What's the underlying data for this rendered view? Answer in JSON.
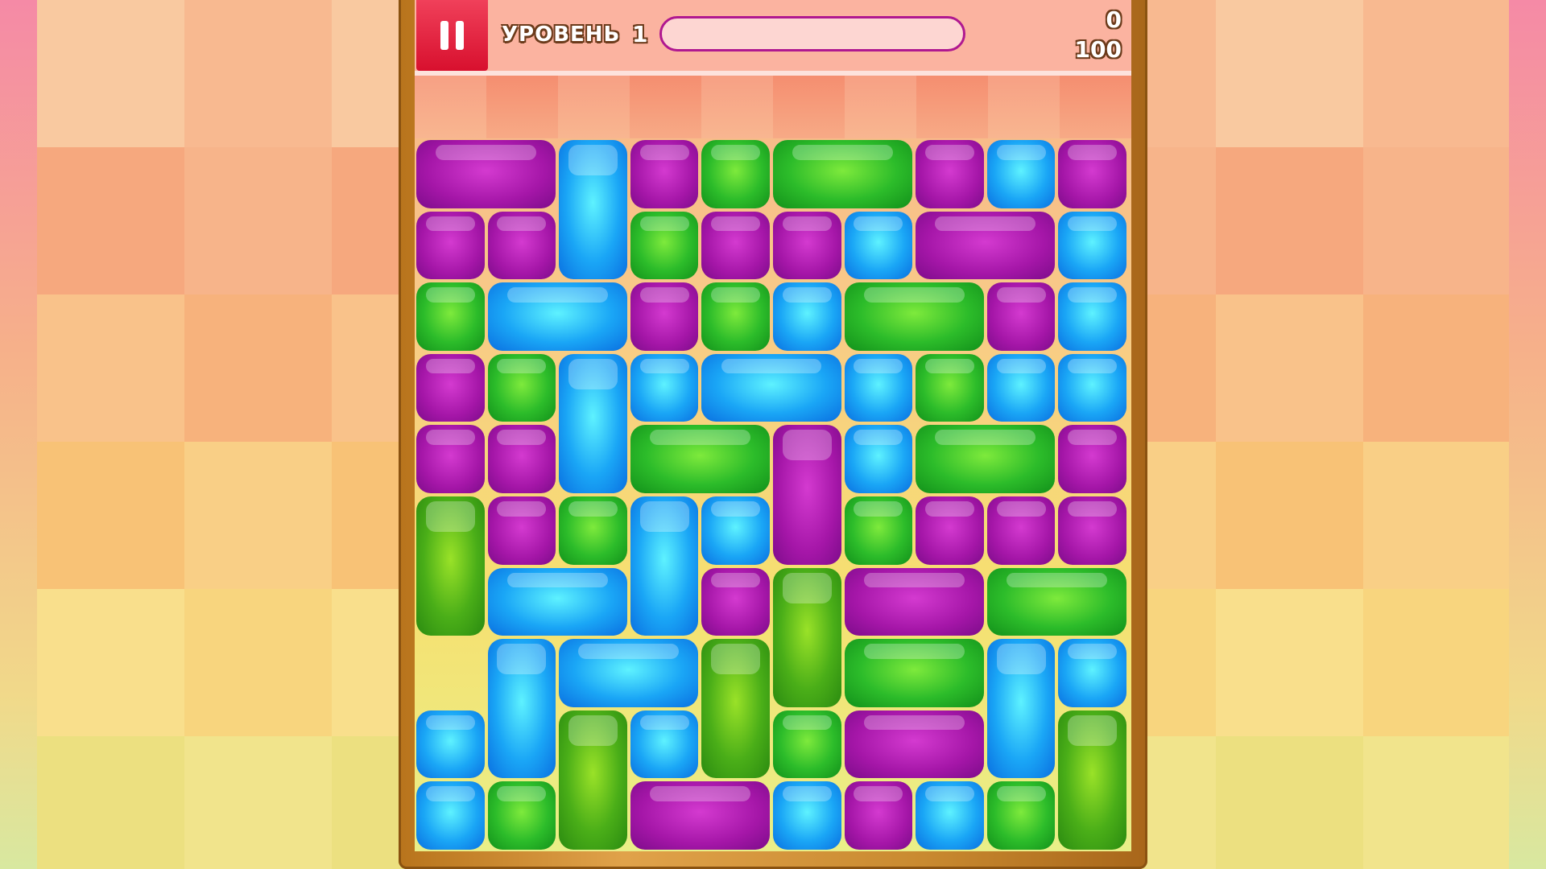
{
  "hud": {
    "level_label": "УРОВЕНЬ",
    "level_number": "1",
    "score_current": "0",
    "score_target": "100",
    "progress_fraction": 0
  },
  "colors": {
    "purple": "#b01ab0",
    "blue": "#1aa6f6",
    "green": "#2cbc2a",
    "pause": "#e0203e"
  },
  "board": {
    "columns": 10,
    "rows": 10,
    "blocks": [
      {
        "c": 0,
        "r": 0,
        "w": 2,
        "h": 1,
        "color": "purple"
      },
      {
        "c": 2,
        "r": 0,
        "w": 1,
        "h": 2,
        "color": "blue"
      },
      {
        "c": 3,
        "r": 0,
        "w": 1,
        "h": 1,
        "color": "purple"
      },
      {
        "c": 4,
        "r": 0,
        "w": 1,
        "h": 1,
        "color": "green"
      },
      {
        "c": 5,
        "r": 0,
        "w": 2,
        "h": 1,
        "color": "green"
      },
      {
        "c": 7,
        "r": 0,
        "w": 1,
        "h": 1,
        "color": "purple"
      },
      {
        "c": 8,
        "r": 0,
        "w": 1,
        "h": 1,
        "color": "blue"
      },
      {
        "c": 9,
        "r": 0,
        "w": 1,
        "h": 1,
        "color": "purple"
      },
      {
        "c": 0,
        "r": 1,
        "w": 1,
        "h": 1,
        "color": "purple"
      },
      {
        "c": 1,
        "r": 1,
        "w": 1,
        "h": 1,
        "color": "purple"
      },
      {
        "c": 3,
        "r": 1,
        "w": 1,
        "h": 1,
        "color": "green"
      },
      {
        "c": 4,
        "r": 1,
        "w": 1,
        "h": 1,
        "color": "purple"
      },
      {
        "c": 5,
        "r": 1,
        "w": 1,
        "h": 1,
        "color": "purple"
      },
      {
        "c": 6,
        "r": 1,
        "w": 1,
        "h": 1,
        "color": "blue"
      },
      {
        "c": 7,
        "r": 1,
        "w": 2,
        "h": 1,
        "color": "purple"
      },
      {
        "c": 9,
        "r": 1,
        "w": 1,
        "h": 1,
        "color": "blue"
      },
      {
        "c": 0,
        "r": 2,
        "w": 1,
        "h": 1,
        "color": "green"
      },
      {
        "c": 1,
        "r": 2,
        "w": 2,
        "h": 1,
        "color": "blue"
      },
      {
        "c": 3,
        "r": 2,
        "w": 1,
        "h": 1,
        "color": "purple"
      },
      {
        "c": 4,
        "r": 2,
        "w": 1,
        "h": 1,
        "color": "green"
      },
      {
        "c": 5,
        "r": 2,
        "w": 1,
        "h": 1,
        "color": "blue"
      },
      {
        "c": 6,
        "r": 2,
        "w": 2,
        "h": 1,
        "color": "green"
      },
      {
        "c": 8,
        "r": 2,
        "w": 1,
        "h": 1,
        "color": "purple"
      },
      {
        "c": 9,
        "r": 2,
        "w": 1,
        "h": 1,
        "color": "blue"
      },
      {
        "c": 0,
        "r": 3,
        "w": 1,
        "h": 1,
        "color": "purple"
      },
      {
        "c": 1,
        "r": 3,
        "w": 1,
        "h": 1,
        "color": "green"
      },
      {
        "c": 2,
        "r": 3,
        "w": 1,
        "h": 2,
        "color": "blue"
      },
      {
        "c": 3,
        "r": 3,
        "w": 1,
        "h": 1,
        "color": "blue"
      },
      {
        "c": 4,
        "r": 3,
        "w": 2,
        "h": 1,
        "color": "blue"
      },
      {
        "c": 6,
        "r": 3,
        "w": 1,
        "h": 1,
        "color": "blue"
      },
      {
        "c": 7,
        "r": 3,
        "w": 1,
        "h": 1,
        "color": "green"
      },
      {
        "c": 8,
        "r": 3,
        "w": 1,
        "h": 1,
        "color": "blue"
      },
      {
        "c": 9,
        "r": 3,
        "w": 1,
        "h": 1,
        "color": "blue"
      },
      {
        "c": 0,
        "r": 4,
        "w": 1,
        "h": 1,
        "color": "purple"
      },
      {
        "c": 1,
        "r": 4,
        "w": 1,
        "h": 1,
        "color": "purple"
      },
      {
        "c": 3,
        "r": 4,
        "w": 2,
        "h": 1,
        "color": "green"
      },
      {
        "c": 5,
        "r": 4,
        "w": 1,
        "h": 2,
        "color": "purple"
      },
      {
        "c": 6,
        "r": 4,
        "w": 1,
        "h": 1,
        "color": "blue"
      },
      {
        "c": 7,
        "r": 4,
        "w": 2,
        "h": 1,
        "color": "green"
      },
      {
        "c": 9,
        "r": 4,
        "w": 1,
        "h": 1,
        "color": "purple"
      },
      {
        "c": 0,
        "r": 5,
        "w": 1,
        "h": 2,
        "color": "green"
      },
      {
        "c": 1,
        "r": 5,
        "w": 1,
        "h": 1,
        "color": "purple"
      },
      {
        "c": 2,
        "r": 5,
        "w": 1,
        "h": 1,
        "color": "green"
      },
      {
        "c": 3,
        "r": 5,
        "w": 1,
        "h": 2,
        "color": "blue"
      },
      {
        "c": 4,
        "r": 5,
        "w": 1,
        "h": 1,
        "color": "blue"
      },
      {
        "c": 6,
        "r": 5,
        "w": 1,
        "h": 1,
        "color": "green"
      },
      {
        "c": 7,
        "r": 5,
        "w": 1,
        "h": 1,
        "color": "purple"
      },
      {
        "c": 8,
        "r": 5,
        "w": 1,
        "h": 1,
        "color": "purple"
      },
      {
        "c": 9,
        "r": 5,
        "w": 1,
        "h": 1,
        "color": "purple"
      },
      {
        "c": 1,
        "r": 6,
        "w": 2,
        "h": 1,
        "color": "blue"
      },
      {
        "c": 4,
        "r": 6,
        "w": 1,
        "h": 1,
        "color": "purple"
      },
      {
        "c": 5,
        "r": 6,
        "w": 1,
        "h": 2,
        "color": "green"
      },
      {
        "c": 6,
        "r": 6,
        "w": 2,
        "h": 1,
        "color": "purple"
      },
      {
        "c": 8,
        "r": 6,
        "w": 2,
        "h": 1,
        "color": "green"
      },
      {
        "c": 1,
        "r": 7,
        "w": 1,
        "h": 2,
        "color": "blue"
      },
      {
        "c": 2,
        "r": 7,
        "w": 2,
        "h": 1,
        "color": "blue"
      },
      {
        "c": 4,
        "r": 7,
        "w": 1,
        "h": 2,
        "color": "green"
      },
      {
        "c": 6,
        "r": 7,
        "w": 2,
        "h": 1,
        "color": "green"
      },
      {
        "c": 8,
        "r": 7,
        "w": 1,
        "h": 2,
        "color": "blue"
      },
      {
        "c": 9,
        "r": 7,
        "w": 1,
        "h": 1,
        "color": "blue"
      },
      {
        "c": 0,
        "r": 8,
        "w": 1,
        "h": 1,
        "color": "blue"
      },
      {
        "c": 2,
        "r": 8,
        "w": 1,
        "h": 2,
        "color": "green"
      },
      {
        "c": 3,
        "r": 8,
        "w": 1,
        "h": 1,
        "color": "blue"
      },
      {
        "c": 5,
        "r": 8,
        "w": 1,
        "h": 1,
        "color": "green"
      },
      {
        "c": 6,
        "r": 8,
        "w": 2,
        "h": 1,
        "color": "purple"
      },
      {
        "c": 9,
        "r": 8,
        "w": 1,
        "h": 2,
        "color": "green"
      },
      {
        "c": 0,
        "r": 9,
        "w": 1,
        "h": 1,
        "color": "blue"
      },
      {
        "c": 1,
        "r": 9,
        "w": 1,
        "h": 1,
        "color": "green"
      },
      {
        "c": 3,
        "r": 9,
        "w": 2,
        "h": 1,
        "color": "purple"
      },
      {
        "c": 5,
        "r": 9,
        "w": 1,
        "h": 1,
        "color": "blue"
      },
      {
        "c": 6,
        "r": 9,
        "w": 1,
        "h": 1,
        "color": "purple"
      },
      {
        "c": 7,
        "r": 9,
        "w": 1,
        "h": 1,
        "color": "blue"
      },
      {
        "c": 8,
        "r": 9,
        "w": 1,
        "h": 1,
        "color": "green"
      }
    ]
  }
}
